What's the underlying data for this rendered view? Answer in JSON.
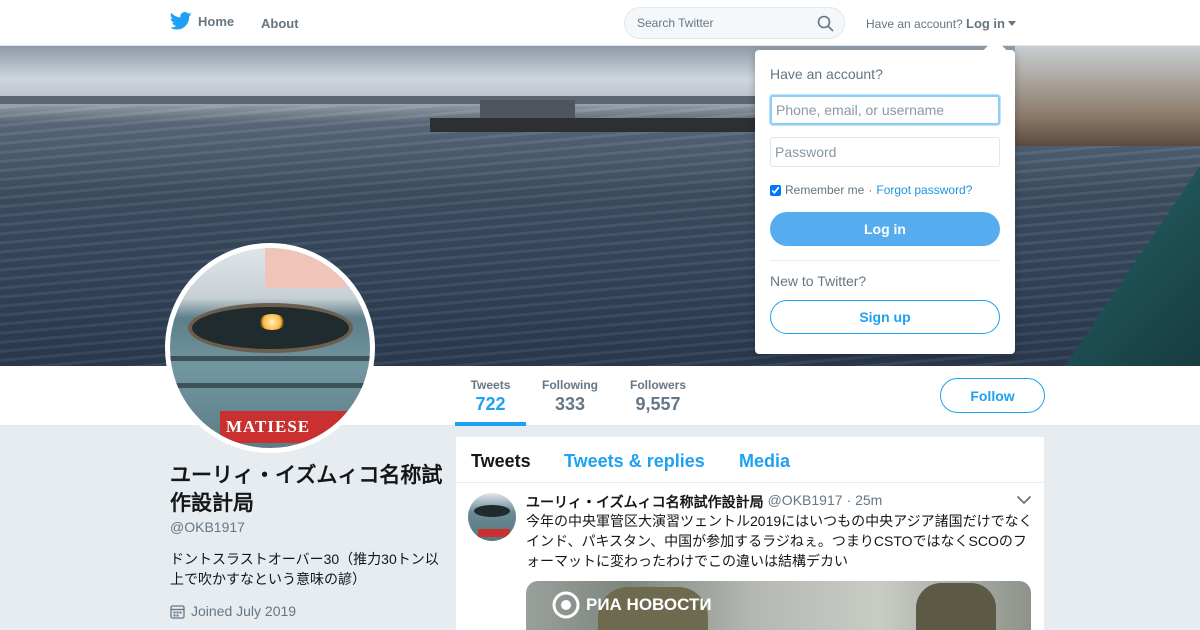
{
  "nav": {
    "home_label": "Home",
    "about_label": "About",
    "search_placeholder": "Search Twitter",
    "have_account": "Have an account?",
    "login_label": "Log in"
  },
  "avatar_label": "MATIESE",
  "stats": {
    "tweets_label": "Tweets",
    "tweets_value": "722",
    "following_label": "Following",
    "following_value": "333",
    "followers_label": "Followers",
    "followers_value": "9,557"
  },
  "follow_label": "Follow",
  "profile": {
    "name": "ユーリィ・イズムィコ名称試作設計局",
    "handle": "@OKB1917",
    "bio": "ドントスラストオーバー30（推力30トン以上で吹かすなという意味の諺）",
    "joined": "Joined July 2019"
  },
  "timeline": {
    "tabs": [
      "Tweets",
      "Tweets & replies",
      "Media"
    ],
    "tweet": {
      "name": "ユーリィ・イズムィコ名称試作設計局",
      "handle": "@OKB1917",
      "time": "· 25m",
      "text": "今年の中央軍管区大演習ツェントル2019にはいつもの中央アジア諸国だけでなくインド、パキスタン、中国が参加するラジねぇ。つまりCSTOではなくSCOのフォーマットに変わったわけでこの違いは結構デカい",
      "media_logo": "РИА НОВОСТИ",
      "avatar_label": "MATIESE"
    }
  },
  "login_dropdown": {
    "title": "Have an account?",
    "username_placeholder": "Phone, email, or username",
    "password_placeholder": "Password",
    "remember_label": "Remember me",
    "separator": "·",
    "forgot_label": "Forgot password?",
    "login_button": "Log in",
    "new_label": "New to Twitter?",
    "signup_button": "Sign up",
    "remember_checked": true
  },
  "colors": {
    "accent": "#1da1f2",
    "login_button": "#55acee",
    "background": "#e6ecf0"
  }
}
